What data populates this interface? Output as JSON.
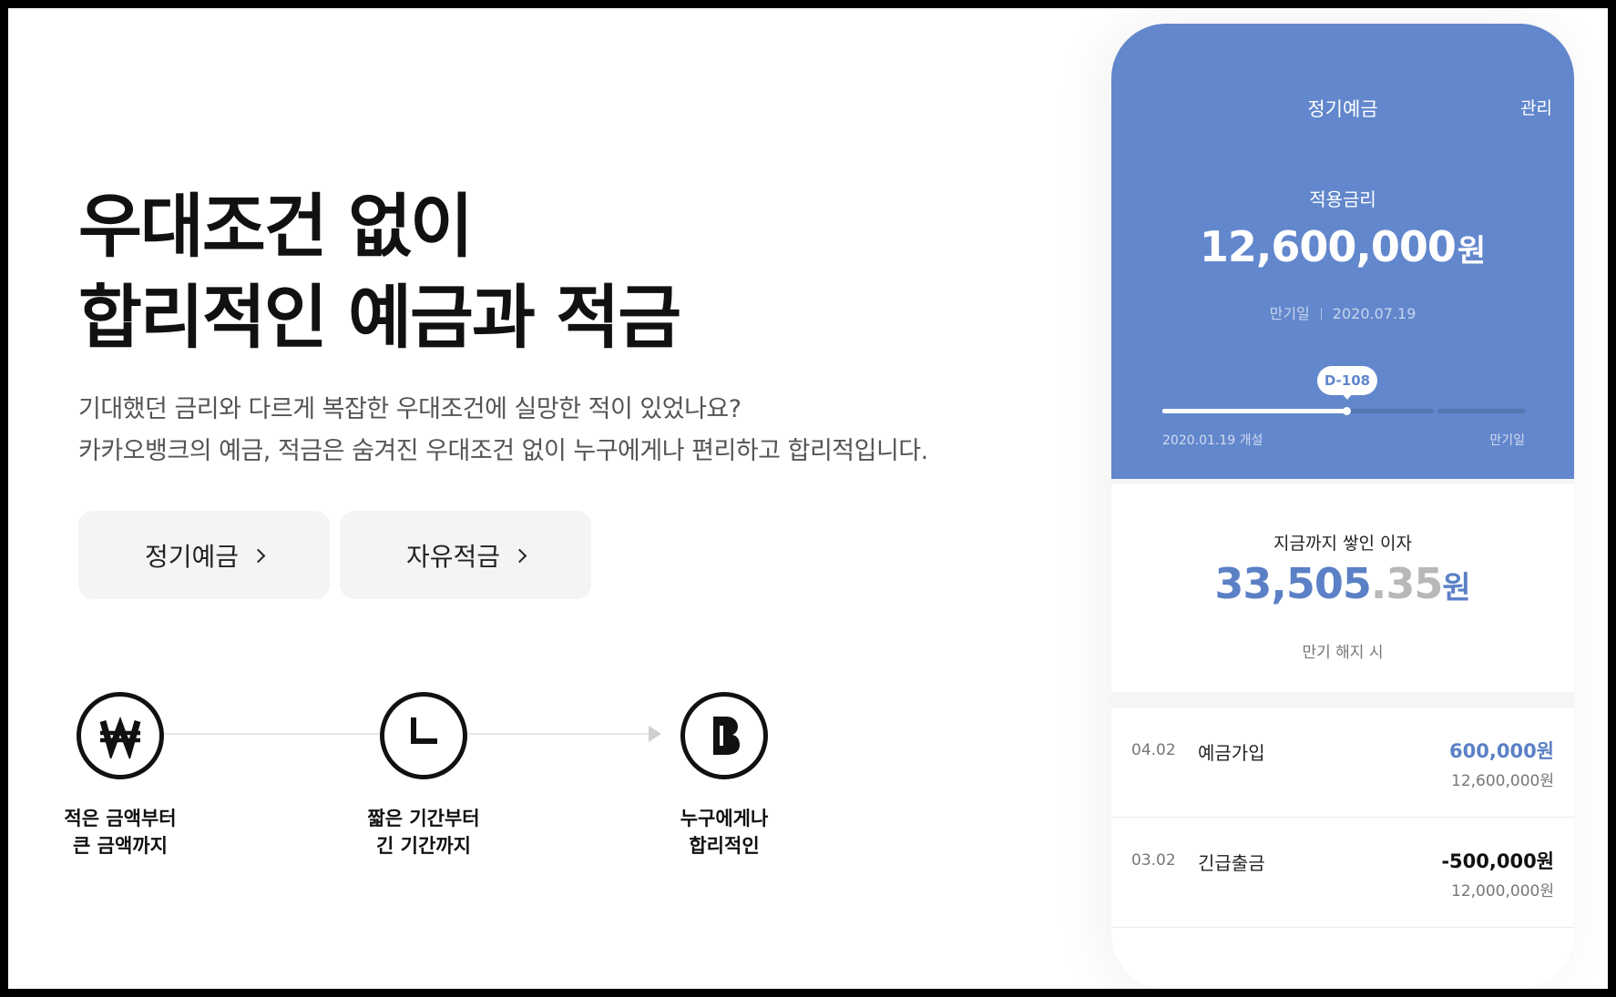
{
  "hero": {
    "title_line1": "우대조건 없이",
    "title_line2": "합리적인 예금과 적금",
    "desc_line1": "기대했던 금리와 다르게 복잡한 우대조건에 실망한 적이 있었나요?",
    "desc_line2": "카카오뱅크의 예금, 적금은 숨겨진 우대조건 없이 누구에게나 편리하고 합리적입니다."
  },
  "buttons": {
    "fixed_deposit": "정기예금",
    "free_savings": "자유적금"
  },
  "steps": [
    {
      "icon": "won-icon",
      "line1": "적은 금액부터",
      "line2": "큰 금액까지"
    },
    {
      "icon": "clock-icon",
      "line1": "짧은 기간부터",
      "line2": "긴 기간까지"
    },
    {
      "icon": "bank-b-icon",
      "line1": "누구에게나",
      "line2": "합리적인"
    }
  ],
  "phone": {
    "title": "정기예금",
    "manage": "관리",
    "rate_label": "적용금리",
    "balance_value": "12,600,000",
    "balance_unit": "원",
    "maturity_label": "만기일",
    "maturity_date": "2020.07.19",
    "dday": "D-108",
    "progress": 0.51,
    "track_start": "2020.01.19 개설",
    "track_end": "만기일",
    "interest_label": "지금까지 쌓인 이자",
    "interest_int": "33,505",
    "interest_dec": ".35",
    "interest_unit": "원",
    "interest_note": "만기 해지 시",
    "transactions": [
      {
        "date": "04.02",
        "name": "예금가입",
        "amount": "600,000원",
        "balance": "12,600,000원"
      },
      {
        "date": "03.02",
        "name": "긴급출금",
        "amount": "-500,000원",
        "balance": "12,000,000원"
      }
    ]
  },
  "colors": {
    "accent": "#6287cc",
    "positive": "#5b80c6",
    "negative": "#111111"
  }
}
